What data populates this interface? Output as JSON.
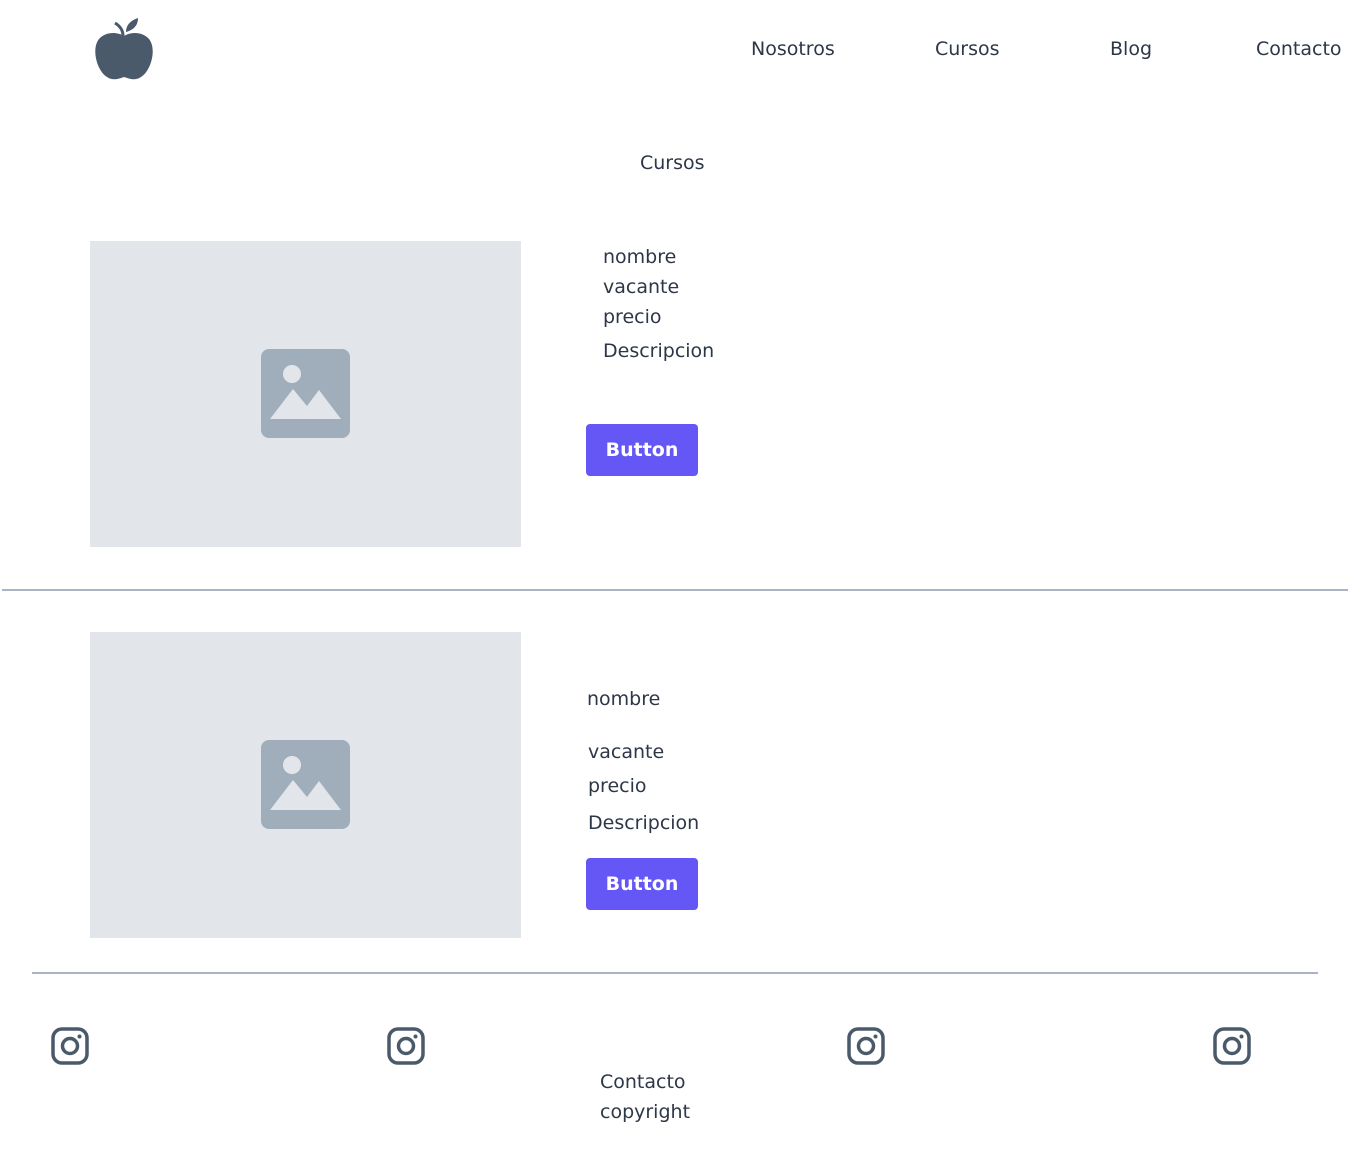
{
  "header": {
    "logo_icon": "apple-icon",
    "nav": [
      "Nosotros",
      "Cursos",
      "Blog",
      "Contacto"
    ]
  },
  "main": {
    "title": "Cursos",
    "courses": [
      {
        "name": "nombre",
        "vacancy": "vacante",
        "price": "precio",
        "description": "Descripcion",
        "button": "Button"
      },
      {
        "name": "nombre",
        "vacancy": "vacante",
        "price": "precio",
        "description": "Descripcion",
        "button": "Button"
      }
    ]
  },
  "footer": {
    "contact": "Contacto",
    "copyright": "copyright",
    "social_icon": "instagram-icon"
  },
  "colors": {
    "accent": "#6457f5",
    "text": "#2d3748",
    "placeholder": "#e2e6ea",
    "divider": "#a9b5c4"
  }
}
